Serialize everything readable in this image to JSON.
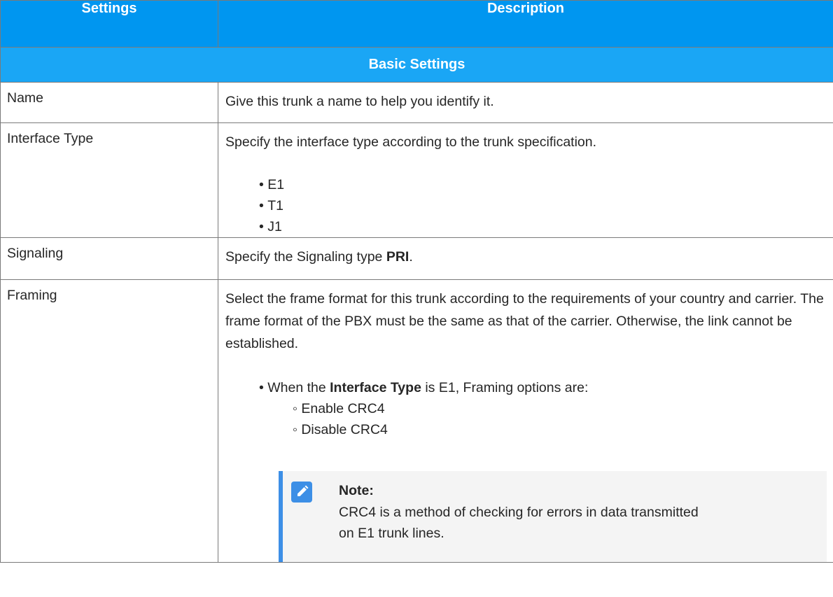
{
  "headers": {
    "settings": "Settings",
    "description": "Description"
  },
  "section_title": "Basic Settings",
  "rows": {
    "name": {
      "label": "Name",
      "desc": "Give this trunk a name to help you identify it."
    },
    "interface_type": {
      "label": "Interface Type",
      "desc": "Specify the interface type according to the trunk specification.",
      "options": [
        "E1",
        "T1",
        "J1"
      ]
    },
    "signaling": {
      "label": "Signaling",
      "desc_prefix": "Specify the Signaling type ",
      "desc_bold": "PRI",
      "desc_suffix": "."
    },
    "framing": {
      "label": "Framing",
      "desc": "Select the frame format for this trunk according to the requirements of your country and carrier. The frame format of the PBX must be the same as that of the carrier. Otherwise, the link cannot be established.",
      "when_prefix": "When the ",
      "when_bold": "Interface Type",
      "when_suffix": " is E1, Framing options are:",
      "options": [
        "Enable CRC4",
        "Disable CRC4"
      ],
      "note_title": "Note:",
      "note_text": "CRC4 is a method of checking for errors in data transmitted on E1 trunk lines."
    }
  },
  "colors": {
    "header_bg": "#0096f0",
    "section_bg": "#1aa6f5",
    "note_border": "#3d8fe6",
    "note_bg": "#f4f4f4"
  },
  "icons": {
    "note": "pencil-note-icon"
  }
}
